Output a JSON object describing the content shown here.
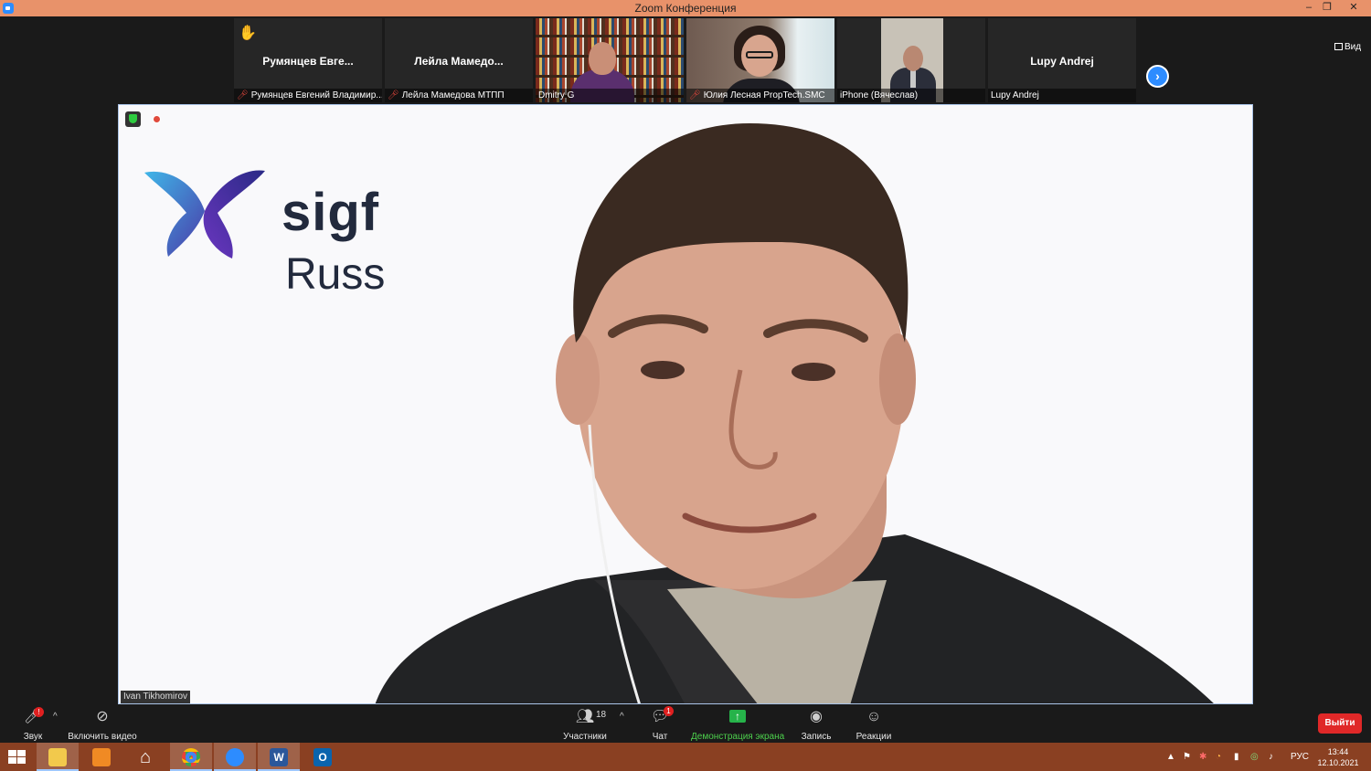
{
  "window": {
    "title": "Zoom Конференция",
    "controls": {
      "minimize": "–",
      "maximize": "❐",
      "close": "✕"
    }
  },
  "strip": {
    "tiles": [
      {
        "name": "Румянцев Евге...",
        "caption": "Румянцев Евгений Владимир...",
        "muted": true,
        "hand_raised": true,
        "video": false
      },
      {
        "name": "Лейла Мамедо...",
        "caption": "Лейла Мамедова МТПП",
        "muted": true,
        "hand_raised": false,
        "video": false
      },
      {
        "name": "",
        "caption": "Dmitry G",
        "muted": false,
        "video": true
      },
      {
        "name": "",
        "caption": "Юлия Лесная PropTech.SMC",
        "muted": true,
        "video": true
      },
      {
        "name": "",
        "caption": "iPhone (Вячеслав)",
        "muted": false,
        "video": true
      },
      {
        "name": "Lupy Andrej",
        "caption": "Lupy Andrej",
        "muted": false,
        "video": false
      }
    ],
    "next_icon": "chevron-right-icon",
    "view_label": "Вид"
  },
  "main": {
    "speaker_name": "Ivan Tikhomirov",
    "logo_text": "sigf",
    "logo_sub": "Russ"
  },
  "toolbar": {
    "audio_label": "Звук",
    "audio_badge": "!",
    "video_label": "Включить видео",
    "participants_label": "Участники",
    "participants_count": "18",
    "chat_label": "Чат",
    "chat_badge": "1",
    "share_label": "Демонстрация экрана",
    "record_label": "Запись",
    "reactions_label": "Реакции",
    "leave_label": "Выйти",
    "share_color": "#4dd04d",
    "leave_color": "#e02828"
  },
  "taskbar": {
    "lang": "РУС",
    "time": "13:44",
    "date": "12.10.2021",
    "apps": [
      "start-icon",
      "file-explorer-icon",
      "media-player-icon",
      "home-icon",
      "chrome-icon",
      "zoom-icon",
      "word-icon",
      "outlook-icon"
    ]
  }
}
